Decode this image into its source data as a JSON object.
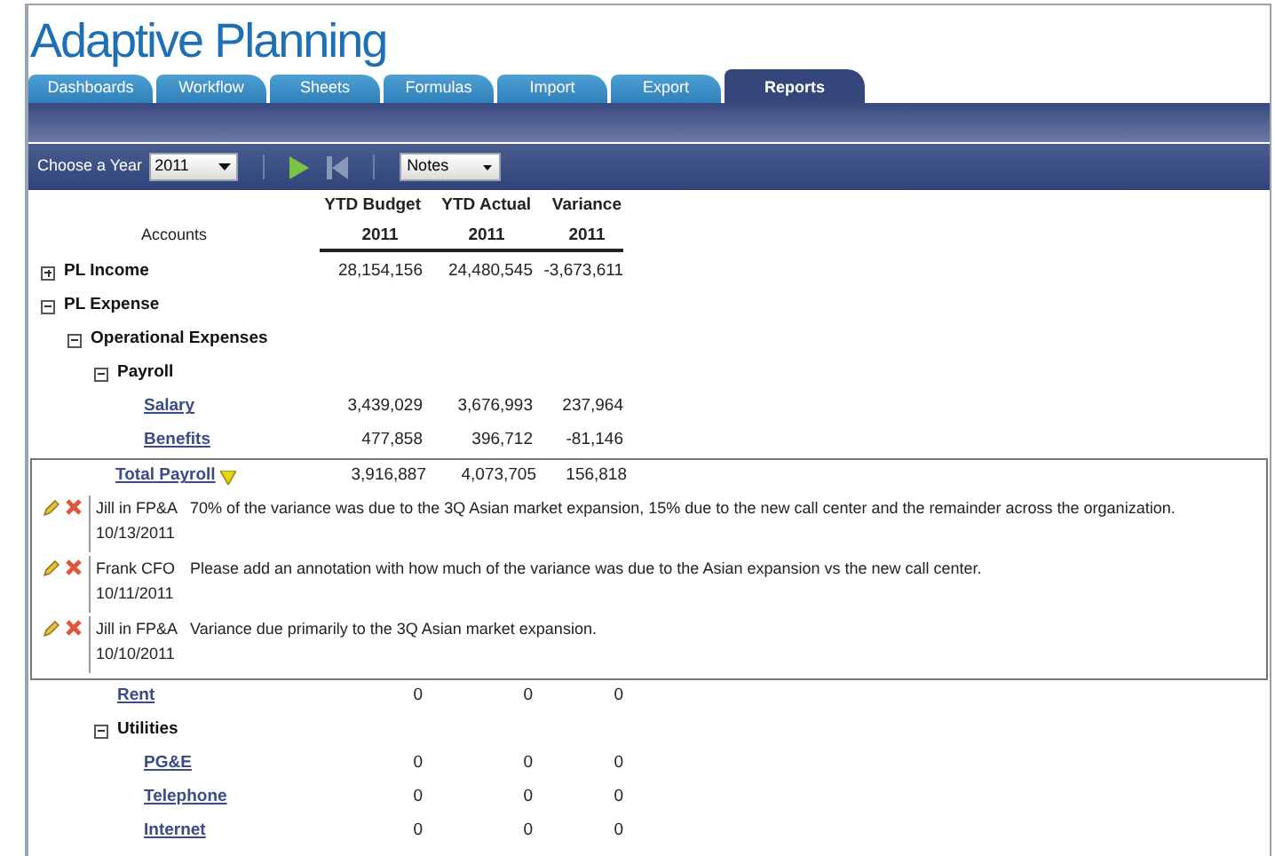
{
  "logo": "Adaptive Planning",
  "tabs": [
    {
      "label": "Dashboards",
      "selected": false
    },
    {
      "label": "Workflow",
      "selected": false
    },
    {
      "label": "Sheets",
      "selected": false
    },
    {
      "label": "Formulas",
      "selected": false
    },
    {
      "label": "Import",
      "selected": false
    },
    {
      "label": "Export",
      "selected": false
    },
    {
      "label": "Reports",
      "selected": true
    }
  ],
  "toolbar": {
    "year_label": "Choose a Year",
    "year_value": "2011",
    "play_disabled": false,
    "back_disabled": true,
    "notes_value": "Notes"
  },
  "table": {
    "accounts_header": "Accounts",
    "columns": [
      {
        "title": "YTD Budget",
        "year": "2011"
      },
      {
        "title": "YTD Actual",
        "year": "2011"
      },
      {
        "title": "Variance",
        "year": "2011"
      }
    ],
    "rows": [
      {
        "kind": "group",
        "name": "PL Income",
        "expanded": false,
        "values": [
          "28,154,156",
          "24,480,545",
          "-3,673,611"
        ]
      },
      {
        "kind": "group",
        "name": "PL Expense",
        "expanded": true,
        "children": [
          {
            "kind": "group",
            "name": "Operational Expenses",
            "expanded": true,
            "children": [
              {
                "kind": "group",
                "name": "Payroll",
                "expanded": true,
                "children": [
                  {
                    "kind": "leaf",
                    "name": "Salary",
                    "values": [
                      "3,439,029",
                      "3,676,993",
                      "237,964"
                    ]
                  },
                  {
                    "kind": "leaf",
                    "name": "Benefits",
                    "values": [
                      "477,858",
                      "396,712",
                      "-81,146"
                    ]
                  }
                ]
              },
              {
                "kind": "leaf",
                "name": "Total Payroll",
                "annotated": true,
                "values": [
                  "3,916,887",
                  "4,073,705",
                  "156,818"
                ],
                "notes": [
                  {
                    "author": "Jill in FP&A",
                    "date": "10/13/2011",
                    "text": "70% of the variance was due to the 3Q Asian market expansion, 15% due to the new call center and the remainder across the organization."
                  },
                  {
                    "author": "Frank CFO",
                    "date": "10/11/2011",
                    "text": "Please add an annotation with how much of the variance was due to the Asian expansion vs the new call center."
                  },
                  {
                    "author": "Jill in FP&A",
                    "date": "10/10/2011",
                    "text": "Variance due primarily to the 3Q Asian market expansion."
                  }
                ]
              },
              {
                "kind": "leaf",
                "name": "Rent",
                "values": [
                  "0",
                  "0",
                  "0"
                ]
              },
              {
                "kind": "group",
                "name": "Utilities",
                "expanded": true,
                "children": [
                  {
                    "kind": "leaf",
                    "name": "PG&E",
                    "values": [
                      "0",
                      "0",
                      "0"
                    ]
                  },
                  {
                    "kind": "leaf",
                    "name": "Telephone",
                    "values": [
                      "0",
                      "0",
                      "0"
                    ]
                  },
                  {
                    "kind": "leaf",
                    "name": "Internet",
                    "values": [
                      "0",
                      "0",
                      "0"
                    ]
                  }
                ]
              }
            ]
          }
        ]
      }
    ]
  }
}
